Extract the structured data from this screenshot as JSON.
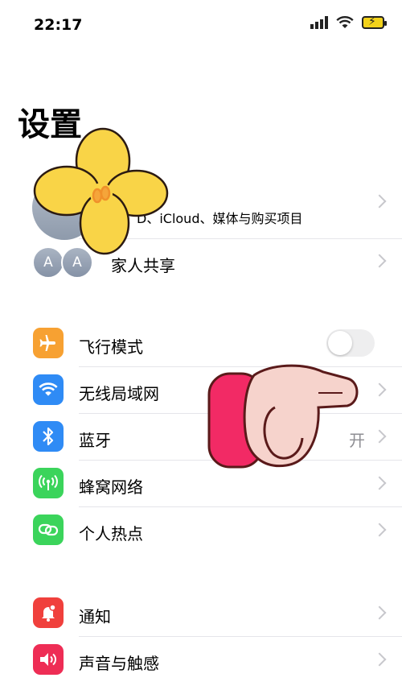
{
  "status_bar": {
    "time": "22:17"
  },
  "header": {
    "title": "设置"
  },
  "account": {
    "subtitle": "D、iCloud、媒体与购买项目"
  },
  "family": {
    "label": "家人共享",
    "avatar_1": "A",
    "avatar_2": "A"
  },
  "group1": [
    {
      "label": "飞行模式",
      "icon": "airplane-icon",
      "color": "#F7A132"
    },
    {
      "label": "无线局域网",
      "icon": "wifi-icon",
      "color": "#2F8BF5"
    },
    {
      "label": "蓝牙",
      "icon": "bluetooth-icon",
      "color": "#2F8BF5",
      "value": "开"
    },
    {
      "label": "蜂窝网络",
      "icon": "cellular-icon",
      "color": "#3BD45B"
    },
    {
      "label": "个人热点",
      "icon": "hotspot-icon",
      "color": "#3BD45B"
    }
  ],
  "group2": [
    {
      "label": "通知",
      "icon": "notification-icon",
      "color": "#F0403C"
    },
    {
      "label": "声音与触感",
      "icon": "sound-icon",
      "color": "#EE2D55"
    }
  ]
}
